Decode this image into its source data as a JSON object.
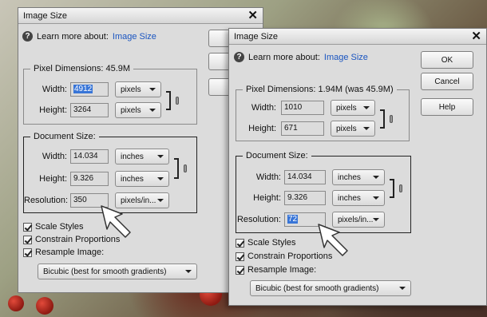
{
  "dialog_left": {
    "title": "Image Size",
    "help_prefix": "Learn more about:",
    "help_link": "Image Size",
    "pixel_dimensions_label": "Pixel Dimensions:",
    "pixel_dimensions_value": "45.9M",
    "width_label": "Width:",
    "width_value": "4912",
    "width_unit": "pixels",
    "height_label": "Height:",
    "height_value": "3264",
    "height_unit": "pixels",
    "document_size_label": "Document Size:",
    "doc_width_label": "Width:",
    "doc_width_value": "14.034",
    "doc_width_unit": "inches",
    "doc_height_label": "Height:",
    "doc_height_value": "9.326",
    "doc_height_unit": "inches",
    "resolution_label": "Resolution:",
    "resolution_value": "350",
    "resolution_unit": "pixels/in...",
    "scale_styles": "Scale Styles",
    "constrain": "Constrain Proportions",
    "resample": "Resample Image:",
    "resample_method": "Bicubic (best for smooth gradients)"
  },
  "dialog_right": {
    "title": "Image Size",
    "help_prefix": "Learn more about:",
    "help_link": "Image Size",
    "ok": "OK",
    "cancel": "Cancel",
    "help": "Help",
    "pixel_dimensions_label": "Pixel Dimensions:",
    "pixel_dimensions_value": "1.94M (was 45.9M)",
    "width_label": "Width:",
    "width_value": "1010",
    "width_unit": "pixels",
    "height_label": "Height:",
    "height_value": "671",
    "height_unit": "pixels",
    "document_size_label": "Document Size:",
    "doc_width_label": "Width:",
    "doc_width_value": "14.034",
    "doc_width_unit": "inches",
    "doc_height_label": "Height:",
    "doc_height_value": "9.326",
    "doc_height_unit": "inches",
    "resolution_label": "Resolution:",
    "resolution_value": "72",
    "resolution_unit": "pixels/in...",
    "scale_styles": "Scale Styles",
    "constrain": "Constrain Proportions",
    "resample": "Resample Image:",
    "resample_method": "Bicubic (best for smooth gradients)"
  },
  "icons": {
    "help": "question-circle-icon",
    "close": "close-icon",
    "pointer": "arrow-cursor-icon",
    "link": "chain-link-icon"
  }
}
